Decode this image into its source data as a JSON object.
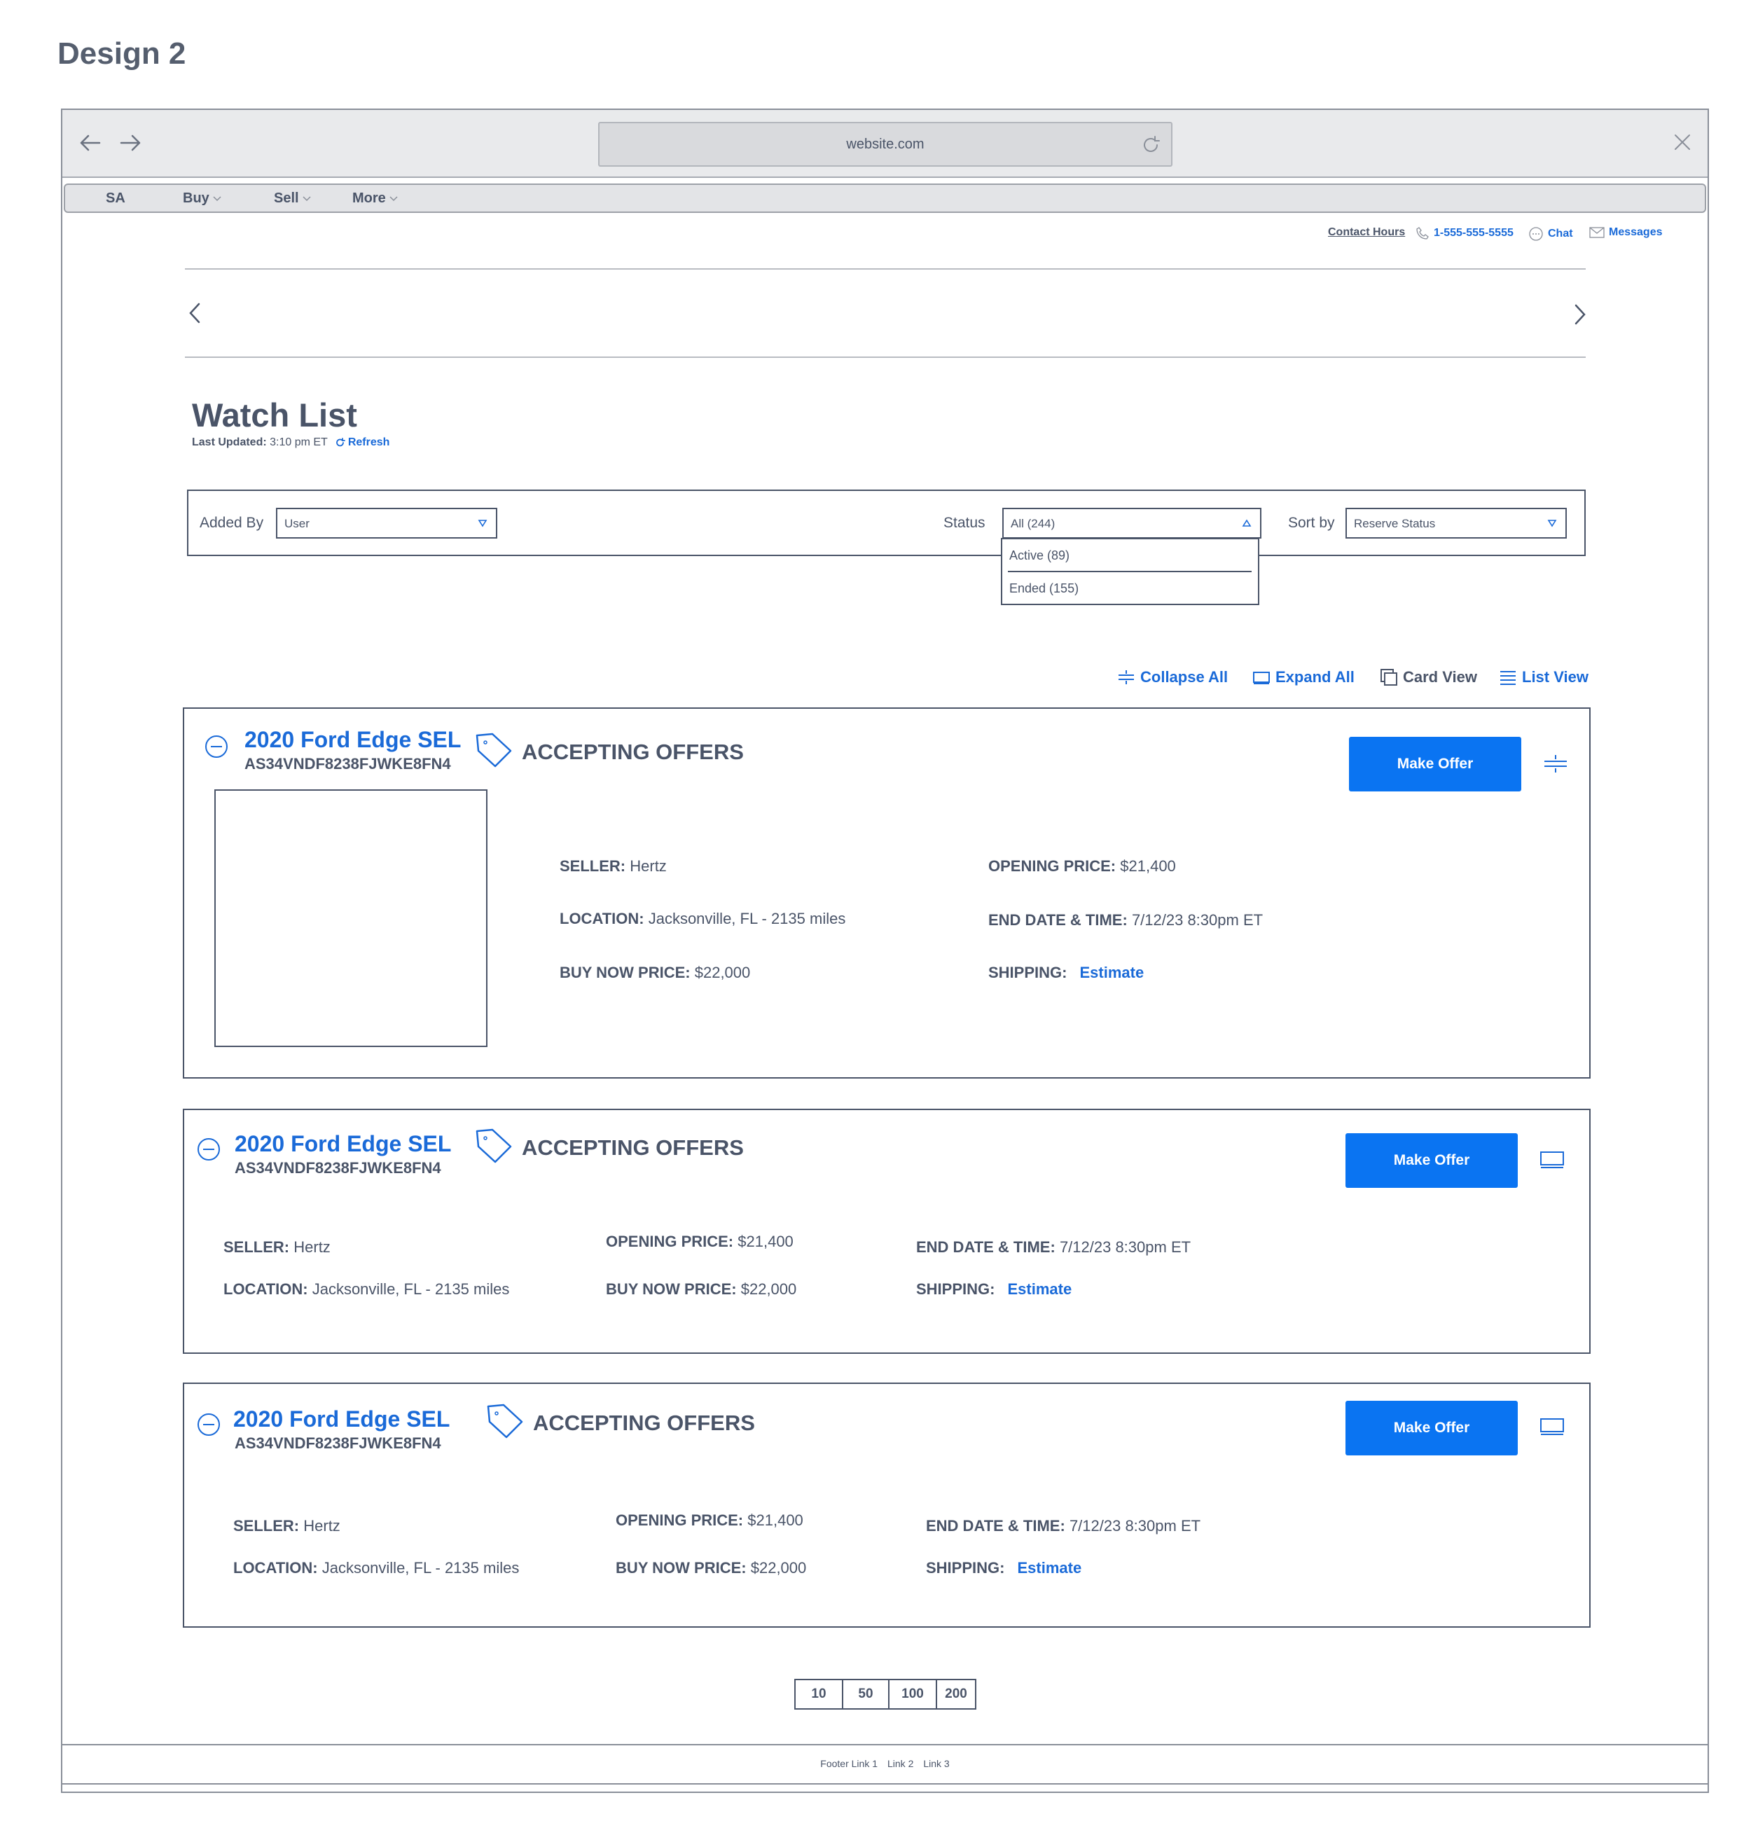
{
  "design_title": "Design 2",
  "browser": {
    "url": "website.com"
  },
  "menu": {
    "brand": "SA",
    "items": [
      {
        "label": "Buy"
      },
      {
        "label": "Sell"
      },
      {
        "label": "More"
      }
    ]
  },
  "utility": {
    "contact_hours": "Contact Hours",
    "phone": "1-555-555-5555",
    "chat": "Chat",
    "messages": "Messages"
  },
  "page": {
    "title": "Watch List",
    "last_updated_label": "Last Updated:",
    "last_updated_value": "3:10 pm ET",
    "refresh": "Refresh"
  },
  "filters": {
    "added_by_label": "Added By",
    "added_by_value": "User",
    "status_label": "Status",
    "status_value": "All (244)",
    "status_options": [
      "Active (89)",
      "Ended (155)"
    ],
    "sort_label": "Sort by",
    "sort_value": "Reserve Status"
  },
  "view_controls": {
    "collapse_all": "Collapse All",
    "expand_all": "Expand All",
    "card_view": "Card View",
    "list_view": "List View"
  },
  "listings": [
    {
      "title": "2020 Ford Edge SEL",
      "vin": "AS34VNDF8238FJWKE8FN4",
      "badge": "ACCEPTING OFFERS",
      "button": "Make Offer",
      "seller_k": "SELLER:",
      "seller_v": "Hertz",
      "location_k": "LOCATION:",
      "location_v": "Jacksonville, FL - 2135 miles",
      "buynow_k": "BUY NOW PRICE:",
      "buynow_v": "$22,000",
      "opening_k": "OPENING PRICE:",
      "opening_v": "$21,400",
      "enddate_k": "END DATE & TIME:",
      "enddate_v": "7/12/23 8:30pm ET",
      "shipping_k": "SHIPPING:",
      "shipping_v": "Estimate"
    },
    {
      "title": "2020 Ford Edge SEL",
      "vin": "AS34VNDF8238FJWKE8FN4",
      "badge": "ACCEPTING OFFERS",
      "button": "Make Offer",
      "seller_k": "SELLER:",
      "seller_v": "Hertz",
      "location_k": "LOCATION:",
      "location_v": "Jacksonville, FL - 2135 miles",
      "buynow_k": "BUY NOW PRICE:",
      "buynow_v": "$22,000",
      "opening_k": "OPENING PRICE:",
      "opening_v": "$21,400",
      "enddate_k": "END DATE & TIME:",
      "enddate_v": "7/12/23 8:30pm ET",
      "shipping_k": "SHIPPING:",
      "shipping_v": "Estimate"
    },
    {
      "title": "2020 Ford Edge SEL",
      "vin": "AS34VNDF8238FJWKE8FN4",
      "badge": "ACCEPTING OFFERS",
      "button": "Make Offer",
      "seller_k": "SELLER:",
      "seller_v": "Hertz",
      "location_k": "LOCATION:",
      "location_v": "Jacksonville, FL - 2135 miles",
      "buynow_k": "BUY NOW PRICE:",
      "buynow_v": "$22,000",
      "opening_k": "OPENING PRICE:",
      "opening_v": "$21,400",
      "enddate_k": "END DATE & TIME:",
      "enddate_v": "7/12/23 8:30pm ET",
      "shipping_k": "SHIPPING:",
      "shipping_v": "Estimate"
    }
  ],
  "pagination": [
    "10",
    "50",
    "100",
    "200"
  ],
  "footer": [
    "Footer Link 1",
    "Link 2",
    "Link 3"
  ],
  "colors": {
    "accent": "#1a6ad8",
    "button": "#0a74f2",
    "text": "#4a5468"
  }
}
